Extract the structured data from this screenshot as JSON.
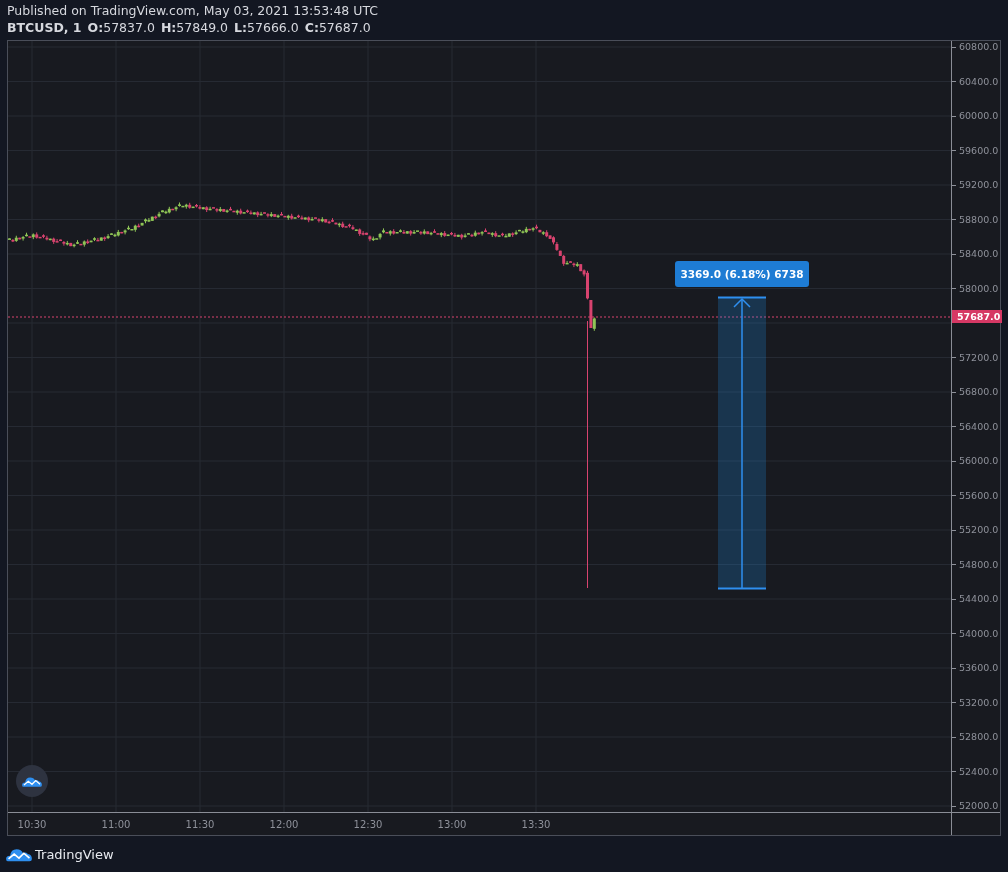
{
  "header": {
    "published": "Published on TradingView.com, May 03, 2021 13:53:48 UTC",
    "symbol": "BTCUSD, 1",
    "ohlc": [
      "**O:**57837.0",
      "**H:**57849.0",
      "**L:**57666.0",
      "**C:**57687.0"
    ]
  },
  "chart": {
    "price_axis_upper": [
      "60800.0",
      "60400.0",
      "60000.0",
      "59600.0",
      "59200.0",
      "58800.0",
      "58400.0",
      "58000.0"
    ],
    "price_axis_lower": [
      "57200.0",
      "56800.0",
      "56400.0",
      "56000.0",
      "55600.0",
      "55200.0",
      "54800.0",
      "54400.0",
      "54000.0",
      "53600.0",
      "53200.0",
      "52800.0",
      "52400.0",
      "52000.0"
    ],
    "time_axis": [
      "10:30",
      "11:00",
      "11:30",
      "12:00",
      "12:30",
      "13:00",
      "13:30"
    ],
    "last_price": "57687.0",
    "measure_label": "3369.0 (6.18%) 6738"
  },
  "footer": {
    "brand": "TradingView"
  }
}
